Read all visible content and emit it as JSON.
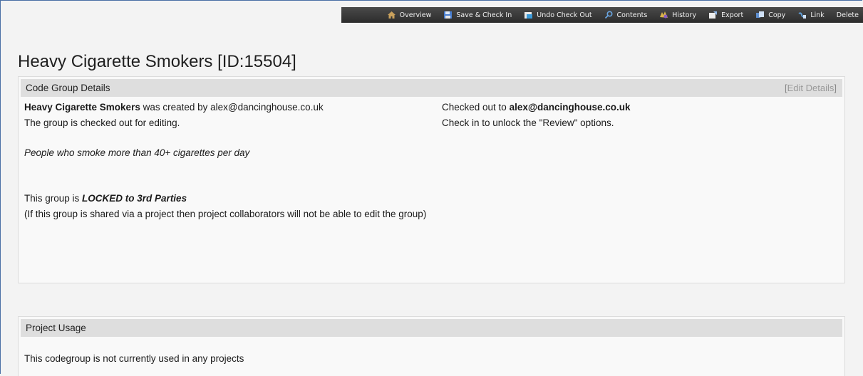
{
  "toolbar": {
    "items": [
      {
        "label": "Overview",
        "icon": "home-icon",
        "color": "#c9a15c"
      },
      {
        "label": "Save & Check In",
        "icon": "save-icon",
        "color": "#4a7fd1"
      },
      {
        "label": "Undo Check Out",
        "icon": "undo-checkout-icon",
        "color": "#3a9ad9"
      },
      {
        "label": "Contents",
        "icon": "magnifier-icon",
        "color": "#6aa5e0"
      },
      {
        "label": "History",
        "icon": "history-icon",
        "color": "#d9b34a"
      },
      {
        "label": "Export",
        "icon": "export-icon",
        "color": "#8fb7e8"
      },
      {
        "label": "Copy",
        "icon": "copy-icon",
        "color": "#5f8fcf"
      },
      {
        "label": "Link",
        "icon": "link-icon",
        "color": "#5f9ed8"
      },
      {
        "label": "Delete",
        "icon": "",
        "color": ""
      }
    ]
  },
  "page": {
    "title": "Heavy Cigarette Smokers [ID:15504]"
  },
  "details": {
    "header": "Code Group Details",
    "edit_open": "[",
    "edit_label": "Edit Details",
    "edit_close": "]",
    "group_name": "Heavy Cigarette Smokers",
    "created_by_text": " was created by alex@dancinghouse.co.uk",
    "checked_out_text": "The group is checked out for editing.",
    "description": "People who smoke more than 40+ cigarettes per day",
    "lock_prefix": "This group is ",
    "lock_status": "LOCKED to 3rd Parties",
    "lock_note": "(If this group is shared via a project then project collaborators will not be able to edit the group)",
    "checked_out_to_prefix": "Checked out to ",
    "checked_out_to_user": "alex@dancinghouse.co.uk",
    "checkin_hint": "Check in to unlock the \"Review\" options."
  },
  "usage": {
    "header": "Project Usage",
    "message": "This codegroup is not currently used in any projects"
  }
}
